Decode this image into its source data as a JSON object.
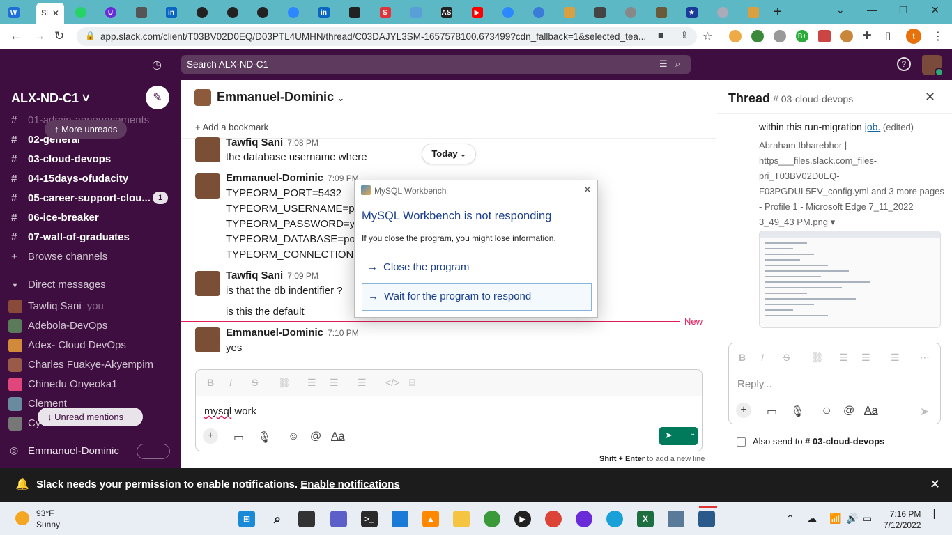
{
  "browser": {
    "active_tab_label": "Sl",
    "url": "app.slack.com/client/T03BV02D0EQ/D03PTL4UMHN/thread/C03DAJYL3SM-1657578100.673499?cdn_fallback=1&selected_tea...",
    "profile_initial": "t"
  },
  "slack": {
    "search_placeholder": "Search ALX-ND-C1",
    "workspace_name": "ALX-ND-C1 ˅",
    "more_unreads": "More unreads",
    "unread_mentions": "Unread mentions",
    "channels": [
      {
        "name": "01-admin-announcements",
        "bold": false
      },
      {
        "name": "02-general",
        "bold": true
      },
      {
        "name": "03-cloud-devops",
        "bold": true
      },
      {
        "name": "04-15days-ofudacity",
        "bold": true
      },
      {
        "name": "05-career-support-clou...",
        "bold": true,
        "badge": "1"
      },
      {
        "name": "06-ice-breaker",
        "bold": true
      },
      {
        "name": "07-wall-of-graduates",
        "bold": true
      }
    ],
    "browse_channels": "Browse channels",
    "direct_messages_label": "Direct messages",
    "dms": [
      {
        "name": "Tawfiq Sani",
        "suffix": "you",
        "color": "#8a4a3a"
      },
      {
        "name": "Adebola-DevOps",
        "suffix": "",
        "color": "#5a7a5a"
      },
      {
        "name": "Adex- Cloud DevOps",
        "suffix": "",
        "color": "#d08a3a"
      },
      {
        "name": "Charles Fuakye-Akyempim",
        "suffix": "",
        "color": "#9a5a4a"
      },
      {
        "name": "Chinedu Onyeoka1",
        "suffix": "",
        "color": "#e0457b"
      },
      {
        "name": "Clement",
        "suffix": "",
        "color": "#6a8aa0"
      },
      {
        "name": "Cy",
        "suffix": "",
        "color": "#777"
      }
    ],
    "huddle_user": "Emmanuel-Dominic"
  },
  "channel": {
    "title": "Emmanuel-Dominic",
    "add_bookmark": "Add a bookmark",
    "today_label": "Today",
    "new_label": "New",
    "messages": [
      {
        "author": "Tawfiq Sani",
        "time": "7:08 PM",
        "lines": [
          "the database username where"
        ]
      },
      {
        "author": "Emmanuel-Dominic",
        "time": "7:09 PM",
        "lines": [
          "TYPEORM_PORT=5432",
          "TYPEORM_USERNAME=po",
          "TYPEORM_PASSWORD=yo",
          "TYPEORM_DATABASE=pos",
          "TYPEORM_CONNECTION="
        ]
      },
      {
        "author": "Tawfiq Sani",
        "time": "7:09 PM",
        "lines": [
          "is that the db indentifier ?",
          "is this the default"
        ]
      },
      {
        "author": "Emmanuel-Dominic",
        "time": "7:10 PM",
        "lines": [
          "yes"
        ]
      }
    ],
    "composer_text_spell": "mysql",
    "composer_text_rest": " work",
    "hint_key": "Shift + Enter",
    "hint_text": " to add a new line"
  },
  "dialog": {
    "window_title": "MySQL Workbench",
    "heading": "MySQL Workbench is not responding",
    "subtext": "If you close the program, you might lose information.",
    "option_close": "Close the program",
    "option_wait": "Wait for the program to respond"
  },
  "thread": {
    "title": "Thread",
    "channel": "# 03-cloud-devops",
    "partial_text": "within this run-migration ",
    "link_text": "job.",
    "edited": " (edited)",
    "file_lines": [
      "Abraham Ibharebhor |",
      "https___files.slack.com_files-",
      "pri_T03BV02D0EQ-",
      "F03PGDUL5EV_config.yml and 3 more pages",
      "- Profile 1 - Microsoft Edge 7_11_2022",
      "3_49_43 PM.png ▾"
    ],
    "reply_placeholder": "Reply...",
    "also_send_label": "Also send to",
    "also_send_channel": "# 03-cloud-devops"
  },
  "notification": {
    "message": "Slack needs your permission to enable notifications.",
    "link": "Enable notifications"
  },
  "taskbar": {
    "temp": "93°F",
    "condition": "Sunny",
    "time": "7:16 PM",
    "date": "7/12/2022"
  }
}
